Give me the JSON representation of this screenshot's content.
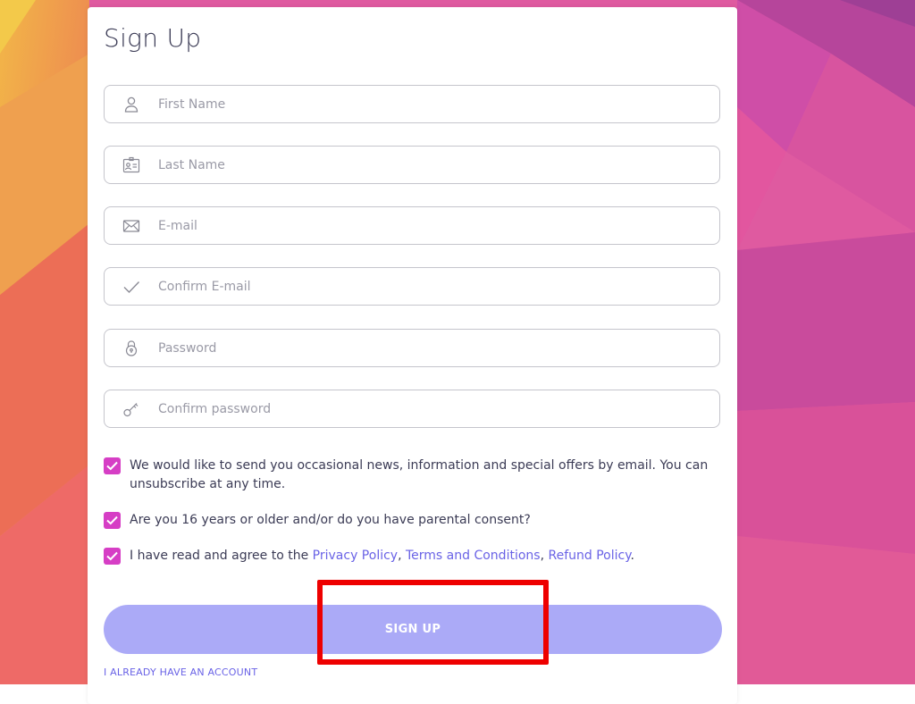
{
  "colors": {
    "accent": "#d63ec5",
    "link": "#6a63e6",
    "button": "#abaaf7",
    "highlight": "#ee0000"
  },
  "form": {
    "title": "Sign Up",
    "fields": [
      {
        "icon": "user-icon",
        "placeholder": "First Name",
        "value": ""
      },
      {
        "icon": "id-card-icon",
        "placeholder": "Last Name",
        "value": ""
      },
      {
        "icon": "envelope-icon",
        "placeholder": "E-mail",
        "value": ""
      },
      {
        "icon": "check-icon",
        "placeholder": "Confirm E-mail",
        "value": ""
      },
      {
        "icon": "lock-icon",
        "placeholder": "Password",
        "value": ""
      },
      {
        "icon": "key-icon",
        "placeholder": "Confirm password",
        "value": ""
      }
    ],
    "checkboxes": {
      "news": {
        "checked": true,
        "label": "We would like to send you occasional news, information and special offers by email. You can unsubscribe at any time."
      },
      "age": {
        "checked": true,
        "label": "Are you 16 years or older and/or do you have parental consent?"
      },
      "agree": {
        "checked": true,
        "prefix": "I have read and agree to the ",
        "privacy": "Privacy Policy",
        "sep1": ", ",
        "terms": "Terms and Conditions",
        "sep2": ", ",
        "refund": "Refund Policy",
        "suffix": "."
      }
    },
    "signup_label": "SIGN UP",
    "have_account_label": "I ALREADY HAVE AN ACCOUNT"
  }
}
